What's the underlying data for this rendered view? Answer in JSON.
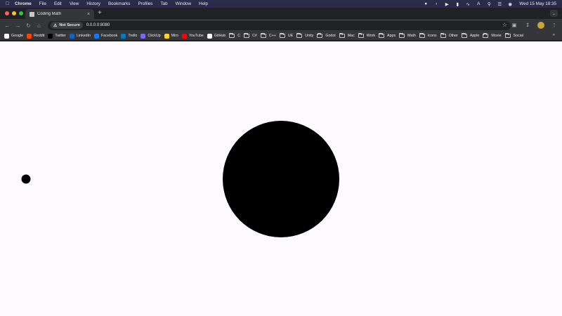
{
  "menubar": {
    "app_name": "Chrome",
    "items": [
      "File",
      "Edit",
      "View",
      "History",
      "Bookmarks",
      "Profiles",
      "Tab",
      "Window",
      "Help"
    ],
    "clock": "Wed 15 May  18:35"
  },
  "tab": {
    "title": "Coding Math",
    "close": "×",
    "new_tab": "+"
  },
  "toolbar": {
    "security_label": "Not Secure",
    "url": "0.0.0.0:8080"
  },
  "bookmarks": [
    {
      "label": "Google",
      "icon": "google-icon",
      "color": "#ffffff"
    },
    {
      "label": "Reddit",
      "icon": "reddit-icon",
      "color": "#ff4500"
    },
    {
      "label": "Twitter",
      "icon": "x-icon",
      "color": "#000000"
    },
    {
      "label": "LinkedIn",
      "icon": "linkedin-icon",
      "color": "#0a66c2"
    },
    {
      "label": "Facebook",
      "icon": "facebook-icon",
      "color": "#1877f2"
    },
    {
      "label": "Trello",
      "icon": "trello-icon",
      "color": "#0079bf"
    },
    {
      "label": "ClickUp",
      "icon": "clickup-icon",
      "color": "#7b68ee"
    },
    {
      "label": "Miro",
      "icon": "miro-icon",
      "color": "#ffd02f"
    },
    {
      "label": "YouTube",
      "icon": "youtube-icon",
      "color": "#ff0000"
    },
    {
      "label": "GitHub",
      "icon": "github-icon",
      "color": "#ffffff"
    },
    {
      "label": "C",
      "icon": "folder-icon"
    },
    {
      "label": "C#",
      "icon": "folder-icon"
    },
    {
      "label": "C++",
      "icon": "folder-icon"
    },
    {
      "label": "UE",
      "icon": "folder-icon"
    },
    {
      "label": "Unity",
      "icon": "folder-icon"
    },
    {
      "label": "Godot",
      "icon": "folder-icon"
    },
    {
      "label": "Mac",
      "icon": "folder-icon"
    },
    {
      "label": "Work",
      "icon": "folder-icon"
    },
    {
      "label": "Apps",
      "icon": "folder-icon"
    },
    {
      "label": "Math",
      "icon": "folder-icon"
    },
    {
      "label": "Icons",
      "icon": "folder-icon"
    },
    {
      "label": "Other",
      "icon": "folder-icon"
    },
    {
      "label": "Apple",
      "icon": "folder-icon"
    },
    {
      "label": "Movie",
      "icon": "folder-icon"
    },
    {
      "label": "Social",
      "icon": "folder-icon"
    }
  ],
  "bookmarks_more": "»",
  "colors": {
    "page_background": "#fcfafd",
    "shape_fill": "#000000",
    "browser_chrome": "#35363a"
  }
}
